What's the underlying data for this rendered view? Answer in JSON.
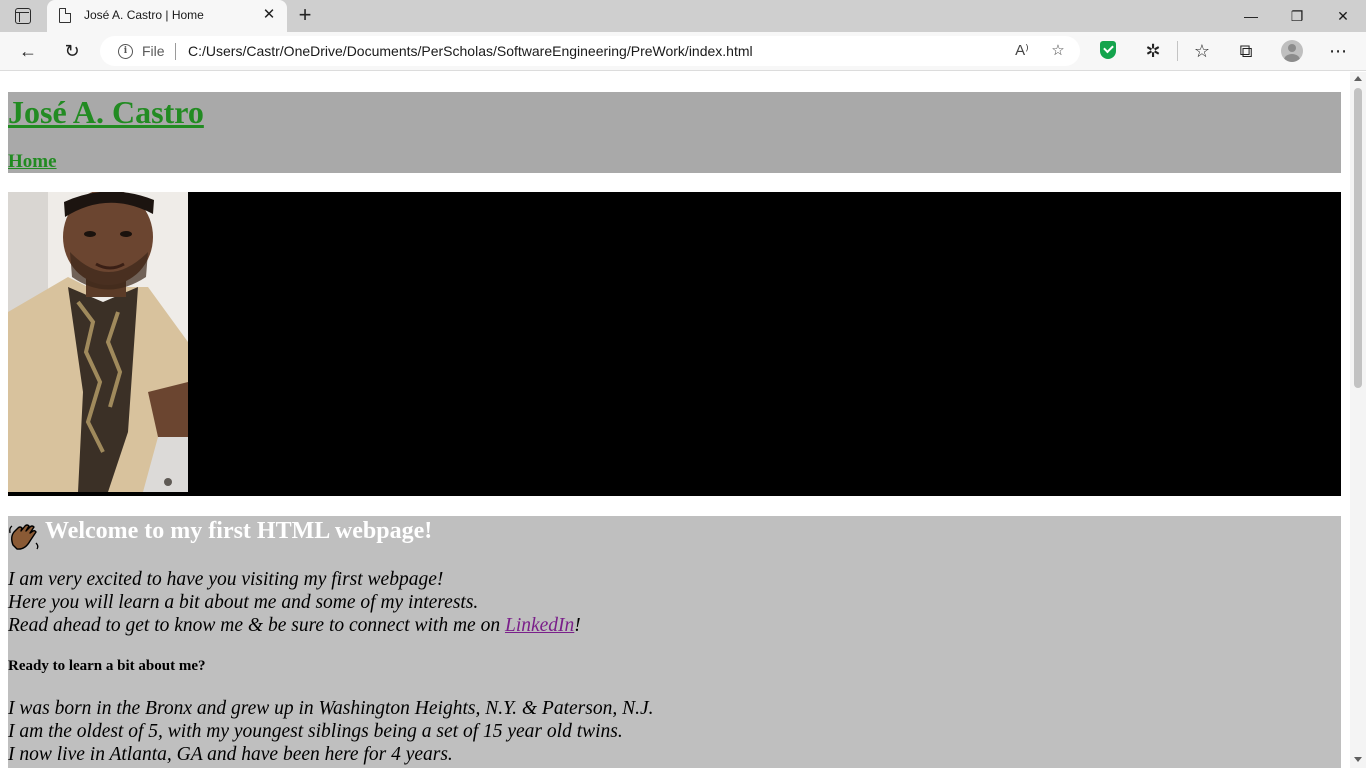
{
  "browser": {
    "tab_title": "José A. Castro | Home",
    "tab_close": "✕",
    "new_tab": "+",
    "window": {
      "minimize": "—",
      "restore": "❐",
      "close": "✕"
    },
    "nav": {
      "back": "←",
      "refresh": "↻"
    },
    "address": {
      "info_glyph": "i",
      "scheme_label": "File",
      "url": "C:/Users/Castr/OneDrive/Documents/PerScholas/SoftwareEngineering/PreWork/index.html",
      "read_aloud_glyph": "A⁾",
      "favorite_glyph": "☆"
    },
    "toolbar": {
      "extensions_glyph": "✲",
      "favorites_glyph": "☆",
      "collections_glyph": "⧉",
      "menu_glyph": "⋯"
    },
    "colors": {
      "tab_strip": "#cfcfcf",
      "toolbar": "#f7f7f7",
      "shield": "#14a44d"
    }
  },
  "page": {
    "site_title": "José A. Castro",
    "nav_home": "Home",
    "welcome_heading": "Welcome to my first HTML webpage!",
    "intro": {
      "line1": "I am very excited to have you visiting my first webpage!",
      "line2": "Here you will learn a bit about me and some of my interests.",
      "line3_before": "Read ahead to get to know me & be sure to connect with me on ",
      "link_text": "LinkedIn",
      "line3_after": "!"
    },
    "subheading": "Ready to learn a bit about me?",
    "about": {
      "line1": "I was born in the Bronx and grew up in Washington Heights, N.Y. & Paterson, N.J.",
      "line2": "I am the oldest of 5, with my youngest siblings being a set of 15 year old twins.",
      "line3": "I now live in Atlanta, GA and have been here for 4 years."
    },
    "colors": {
      "header_bg": "#a9a9a9",
      "title_link": "#228b22",
      "banner_bg": "#000000",
      "content_bg": "#bfbfbf",
      "visited_link": "#7a1f8a"
    }
  }
}
